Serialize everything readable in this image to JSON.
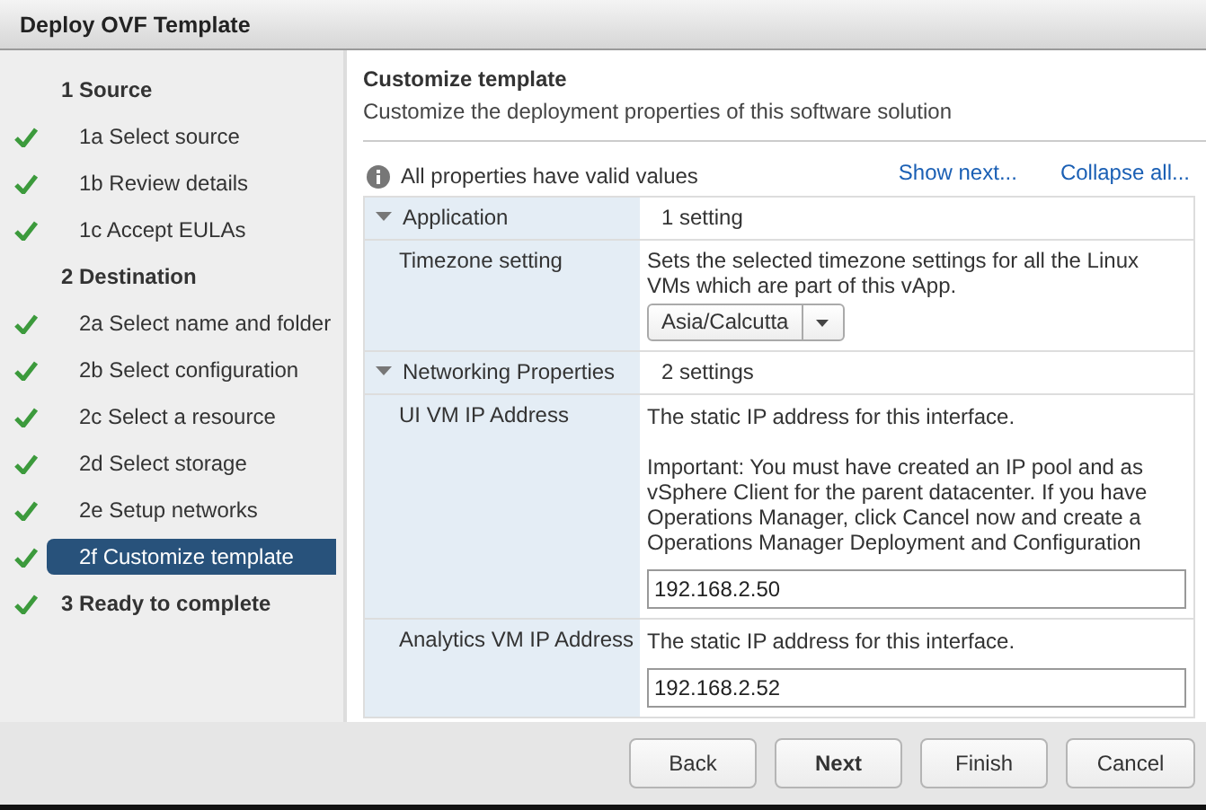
{
  "window": {
    "title": "Deploy OVF Template"
  },
  "steps": [
    {
      "kind": "section",
      "label": "1  Source",
      "checked": false,
      "selected": false
    },
    {
      "kind": "step",
      "label": "1a  Select source",
      "checked": true,
      "selected": false
    },
    {
      "kind": "step",
      "label": "1b  Review details",
      "checked": true,
      "selected": false
    },
    {
      "kind": "step",
      "label": "1c  Accept EULAs",
      "checked": true,
      "selected": false
    },
    {
      "kind": "section",
      "label": "2  Destination",
      "checked": false,
      "selected": false
    },
    {
      "kind": "step",
      "label": "2a  Select name and folder",
      "checked": true,
      "selected": false
    },
    {
      "kind": "step",
      "label": "2b  Select configuration",
      "checked": true,
      "selected": false
    },
    {
      "kind": "step",
      "label": "2c  Select a resource",
      "checked": true,
      "selected": false
    },
    {
      "kind": "step",
      "label": "2d  Select storage",
      "checked": true,
      "selected": false
    },
    {
      "kind": "step",
      "label": "2e  Setup networks",
      "checked": true,
      "selected": false
    },
    {
      "kind": "step",
      "label": "2f Customize template",
      "checked": true,
      "selected": true
    },
    {
      "kind": "section",
      "label": "3  Ready to complete",
      "checked": true,
      "selected": false
    }
  ],
  "page": {
    "title": "Customize template",
    "subtitle": "Customize the deployment properties of this software solution"
  },
  "status": "All properties have valid values",
  "links": [
    "Show next...",
    "Collapse all..."
  ],
  "properties": [
    {
      "kind": "group",
      "label": "Application",
      "expanded": true,
      "summary": "1 setting"
    },
    {
      "kind": "select",
      "label": "Timezone setting",
      "description": [
        "Sets the selected timezone settings for all the Linux",
        "VMs which are part of this vApp."
      ],
      "value": "Asia/Calcutta"
    },
    {
      "kind": "group",
      "label": "Networking Properties",
      "expanded": true,
      "summary": "2 settings"
    },
    {
      "kind": "text",
      "label": "UI VM IP Address",
      "description": [
        "The static IP address for this interface."
      ],
      "note": [
        "Important: You must have created an IP pool and as",
        "vSphere Client for the parent datacenter. If you have",
        "Operations Manager, click Cancel now and create a",
        "Operations Manager Deployment and Configuration"
      ],
      "value": "192.168.2.50"
    },
    {
      "kind": "text",
      "label": "Analytics VM IP Address",
      "description": [
        "The static IP address for this interface."
      ],
      "value": "192.168.2.52"
    }
  ],
  "buttons": [
    {
      "label": "Back",
      "primary": false
    },
    {
      "label": "Next",
      "primary": true
    },
    {
      "label": "Finish",
      "primary": false
    },
    {
      "label": "Cancel",
      "primary": false
    }
  ]
}
